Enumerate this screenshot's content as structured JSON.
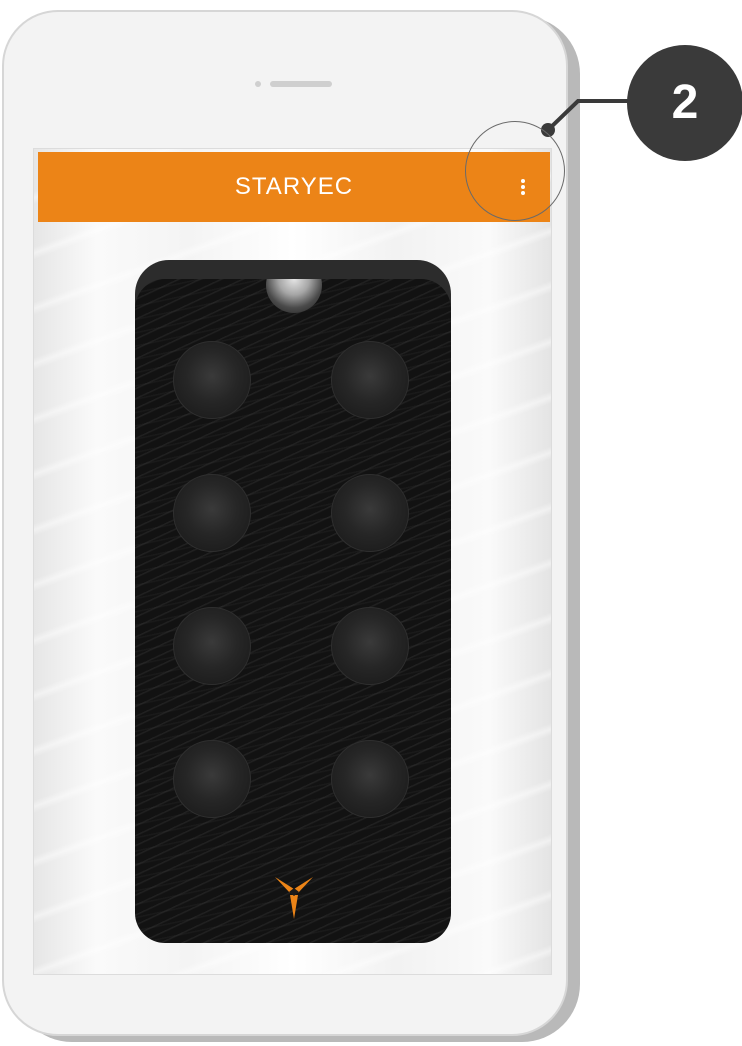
{
  "app": {
    "title": "STARYEC",
    "menu_icon": "more-vertical-icon",
    "accent_color": "#ec8417"
  },
  "remote": {
    "button_count": 8,
    "logo_icon": "starytec-logo-icon",
    "logo_color": "#ec8417"
  },
  "annotation": {
    "step_number": "2",
    "highlight": "menu-button"
  }
}
